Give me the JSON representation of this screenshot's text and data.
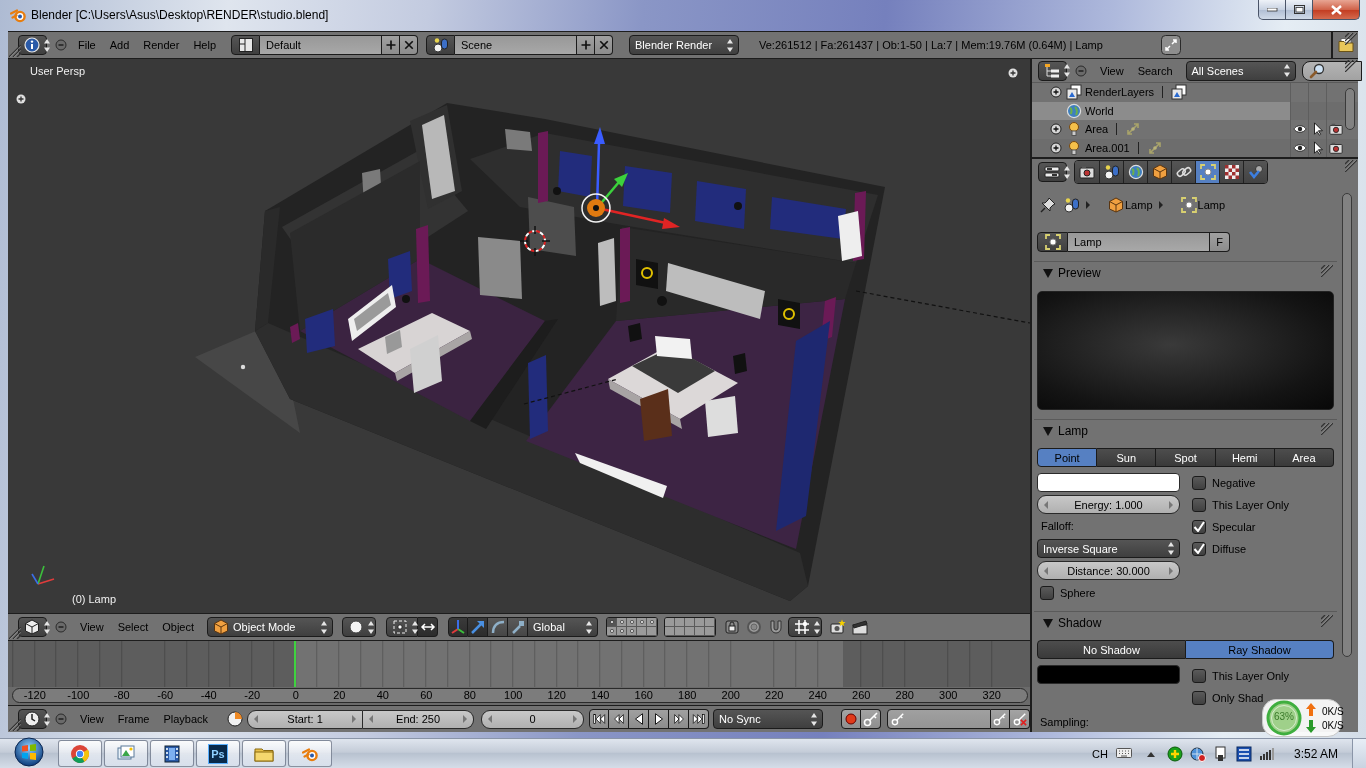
{
  "window": {
    "title": "Blender [C:\\Users\\Asus\\Desktop\\RENDER\\studio.blend]"
  },
  "info_header": {
    "menus": [
      "File",
      "Add",
      "Render",
      "Help"
    ],
    "screen_layout": "Default",
    "scene": "Scene",
    "render_engine": "Blender Render",
    "stats": "Ve:261512 | Fa:261437 | Ob:1-50 | La:7 | Mem:19.76M (0.64M) | Lamp"
  },
  "viewport": {
    "view_name": "User Persp",
    "active_object": "(0) Lamp"
  },
  "viewport_header": {
    "menus": [
      "View",
      "Select",
      "Object"
    ],
    "mode": "Object Mode",
    "manipulators": [
      {
        "kind": "axes",
        "on": true
      },
      {
        "kind": "translate",
        "on": true
      },
      {
        "kind": "rotate",
        "on": false
      },
      {
        "kind": "scale",
        "on": false
      }
    ],
    "orientation": "Global",
    "layers": [
      {
        "used": true,
        "selected": true
      },
      {
        "used": true,
        "selected": false
      },
      {
        "used": true,
        "selected": false
      },
      {
        "used": true,
        "selected": false
      },
      {
        "used": true,
        "selected": false
      },
      {
        "used": true,
        "selected": false
      },
      {
        "used": true,
        "selected": false
      },
      {
        "used": true,
        "selected": false
      },
      {
        "used": false,
        "selected": false
      },
      {
        "used": false,
        "selected": false
      },
      {
        "used": false,
        "selected": false
      },
      {
        "used": false,
        "selected": false
      },
      {
        "used": false,
        "selected": false
      },
      {
        "used": false,
        "selected": false
      },
      {
        "used": false,
        "selected": false
      },
      {
        "used": false,
        "selected": false
      },
      {
        "used": false,
        "selected": false
      },
      {
        "used": false,
        "selected": false
      },
      {
        "used": false,
        "selected": false
      },
      {
        "used": false,
        "selected": false
      }
    ]
  },
  "timeline": {
    "ruler": [
      {
        "label": "-120",
        "current": false
      },
      {
        "label": "-100",
        "current": false
      },
      {
        "label": "-80",
        "current": false
      },
      {
        "label": "-60",
        "current": false
      },
      {
        "label": "-40",
        "current": false
      },
      {
        "label": "-20",
        "current": false
      },
      {
        "label": "0",
        "current": true
      },
      {
        "label": "20",
        "current": false
      },
      {
        "label": "40",
        "current": false
      },
      {
        "label": "60",
        "current": false
      },
      {
        "label": "80",
        "current": false
      },
      {
        "label": "100",
        "current": false
      },
      {
        "label": "120",
        "current": false
      },
      {
        "label": "140",
        "current": false
      },
      {
        "label": "160",
        "current": false
      },
      {
        "label": "180",
        "current": false
      },
      {
        "label": "200",
        "current": false
      },
      {
        "label": "220",
        "current": false
      },
      {
        "label": "240",
        "current": false
      },
      {
        "label": "260",
        "current": false
      },
      {
        "label": "280",
        "current": false
      },
      {
        "label": "300",
        "current": false
      },
      {
        "label": "320",
        "current": false
      }
    ],
    "menus": [
      "View",
      "Frame",
      "Playback"
    ],
    "start": "Start: 1",
    "end": "End: 250",
    "frame": "0",
    "sync": "No Sync"
  },
  "outliner": {
    "menus": [
      "View",
      "Search"
    ],
    "display": "All Scenes",
    "rows": [
      {
        "kind": "render_layers",
        "label": "RenderLayers",
        "expandable": true,
        "expanded": false,
        "selected": false
      },
      {
        "kind": "world",
        "label": "World",
        "expandable": false,
        "expanded": false,
        "selected": true
      },
      {
        "kind": "lamp",
        "label": "Area",
        "expandable": true,
        "expanded": false,
        "selected": false
      },
      {
        "kind": "lamp",
        "label": "Area.001",
        "expandable": true,
        "expanded": false,
        "selected": false
      }
    ]
  },
  "properties": {
    "tabs": [
      {
        "kind": "render",
        "selected": false
      },
      {
        "kind": "scene",
        "selected": false
      },
      {
        "kind": "world",
        "selected": false
      },
      {
        "kind": "object",
        "selected": false
      },
      {
        "kind": "constraints",
        "selected": false
      },
      {
        "kind": "lamp",
        "selected": true
      },
      {
        "kind": "texture",
        "selected": false
      },
      {
        "kind": "physics",
        "selected": false
      }
    ],
    "breadcrumb": [
      {
        "kind": "object",
        "label": "Lamp"
      },
      {
        "kind": "lamp",
        "label": "Lamp"
      }
    ],
    "datablock": {
      "name": "Lamp",
      "fake_user": "F"
    },
    "preview_panel": {
      "title": "Preview",
      "expanded": true
    },
    "lamp_panel": {
      "title": "Lamp",
      "expanded": true,
      "types": [
        {
          "label": "Point",
          "selected": true
        },
        {
          "label": "Sun",
          "selected": false
        },
        {
          "label": "Spot",
          "selected": false
        },
        {
          "label": "Hemi",
          "selected": false
        },
        {
          "label": "Area",
          "selected": false
        }
      ],
      "color": "#ffffff",
      "energy": "Energy: 1.000",
      "falloff_label": "Falloff:",
      "falloff": "Inverse Square",
      "distance": "Distance: 30.000",
      "options": [
        {
          "label": "Negative",
          "checked": false
        },
        {
          "label": "This Layer Only",
          "checked": false
        },
        {
          "label": "Specular",
          "checked": true
        },
        {
          "label": "Diffuse",
          "checked": true
        }
      ],
      "sphere": {
        "label": "Sphere",
        "checked": false
      }
    },
    "shadow_panel": {
      "title": "Shadow",
      "expanded": true,
      "modes": [
        {
          "label": "No Shadow",
          "selected": false
        },
        {
          "label": "Ray Shadow",
          "selected": true
        }
      ],
      "color": "#000000",
      "options": [
        {
          "label": "This Layer Only",
          "checked": false
        },
        {
          "label": "Only Shad",
          "checked": false
        }
      ],
      "sampling_label": "Sampling:"
    }
  },
  "net_monitor": {
    "percent": "63%",
    "upload": "0K/S",
    "download": "0K/S"
  },
  "taskbar": {
    "apps": [
      {
        "kind": "chrome"
      },
      {
        "kind": "photos"
      },
      {
        "kind": "media"
      },
      {
        "kind": "photoshop",
        "label": "Ps"
      },
      {
        "kind": "explorer"
      },
      {
        "kind": "blender"
      }
    ],
    "language": "CH",
    "clock": "3:52 AM"
  }
}
